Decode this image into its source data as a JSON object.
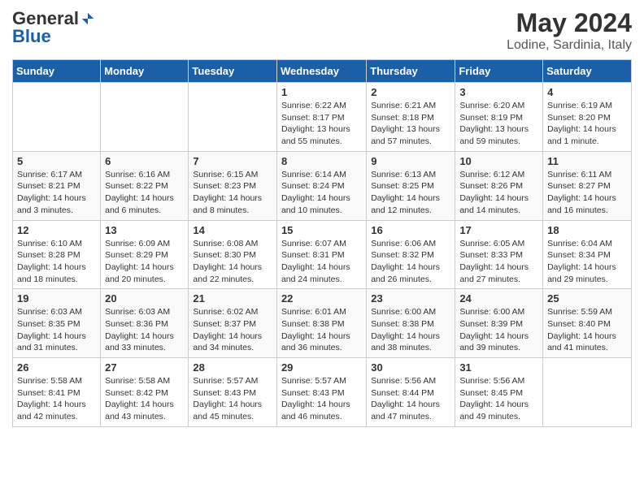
{
  "header": {
    "logo_general": "General",
    "logo_blue": "Blue",
    "month": "May 2024",
    "location": "Lodine, Sardinia, Italy"
  },
  "weekdays": [
    "Sunday",
    "Monday",
    "Tuesday",
    "Wednesday",
    "Thursday",
    "Friday",
    "Saturday"
  ],
  "weeks": [
    [
      null,
      null,
      null,
      {
        "day": 1,
        "sunrise": "6:22 AM",
        "sunset": "8:17 PM",
        "daylight": "13 hours and 55 minutes."
      },
      {
        "day": 2,
        "sunrise": "6:21 AM",
        "sunset": "8:18 PM",
        "daylight": "13 hours and 57 minutes."
      },
      {
        "day": 3,
        "sunrise": "6:20 AM",
        "sunset": "8:19 PM",
        "daylight": "13 hours and 59 minutes."
      },
      {
        "day": 4,
        "sunrise": "6:19 AM",
        "sunset": "8:20 PM",
        "daylight": "14 hours and 1 minute."
      }
    ],
    [
      {
        "day": 5,
        "sunrise": "6:17 AM",
        "sunset": "8:21 PM",
        "daylight": "14 hours and 3 minutes."
      },
      {
        "day": 6,
        "sunrise": "6:16 AM",
        "sunset": "8:22 PM",
        "daylight": "14 hours and 6 minutes."
      },
      {
        "day": 7,
        "sunrise": "6:15 AM",
        "sunset": "8:23 PM",
        "daylight": "14 hours and 8 minutes."
      },
      {
        "day": 8,
        "sunrise": "6:14 AM",
        "sunset": "8:24 PM",
        "daylight": "14 hours and 10 minutes."
      },
      {
        "day": 9,
        "sunrise": "6:13 AM",
        "sunset": "8:25 PM",
        "daylight": "14 hours and 12 minutes."
      },
      {
        "day": 10,
        "sunrise": "6:12 AM",
        "sunset": "8:26 PM",
        "daylight": "14 hours and 14 minutes."
      },
      {
        "day": 11,
        "sunrise": "6:11 AM",
        "sunset": "8:27 PM",
        "daylight": "14 hours and 16 minutes."
      }
    ],
    [
      {
        "day": 12,
        "sunrise": "6:10 AM",
        "sunset": "8:28 PM",
        "daylight": "14 hours and 18 minutes."
      },
      {
        "day": 13,
        "sunrise": "6:09 AM",
        "sunset": "8:29 PM",
        "daylight": "14 hours and 20 minutes."
      },
      {
        "day": 14,
        "sunrise": "6:08 AM",
        "sunset": "8:30 PM",
        "daylight": "14 hours and 22 minutes."
      },
      {
        "day": 15,
        "sunrise": "6:07 AM",
        "sunset": "8:31 PM",
        "daylight": "14 hours and 24 minutes."
      },
      {
        "day": 16,
        "sunrise": "6:06 AM",
        "sunset": "8:32 PM",
        "daylight": "14 hours and 26 minutes."
      },
      {
        "day": 17,
        "sunrise": "6:05 AM",
        "sunset": "8:33 PM",
        "daylight": "14 hours and 27 minutes."
      },
      {
        "day": 18,
        "sunrise": "6:04 AM",
        "sunset": "8:34 PM",
        "daylight": "14 hours and 29 minutes."
      }
    ],
    [
      {
        "day": 19,
        "sunrise": "6:03 AM",
        "sunset": "8:35 PM",
        "daylight": "14 hours and 31 minutes."
      },
      {
        "day": 20,
        "sunrise": "6:03 AM",
        "sunset": "8:36 PM",
        "daylight": "14 hours and 33 minutes."
      },
      {
        "day": 21,
        "sunrise": "6:02 AM",
        "sunset": "8:37 PM",
        "daylight": "14 hours and 34 minutes."
      },
      {
        "day": 22,
        "sunrise": "6:01 AM",
        "sunset": "8:38 PM",
        "daylight": "14 hours and 36 minutes."
      },
      {
        "day": 23,
        "sunrise": "6:00 AM",
        "sunset": "8:38 PM",
        "daylight": "14 hours and 38 minutes."
      },
      {
        "day": 24,
        "sunrise": "6:00 AM",
        "sunset": "8:39 PM",
        "daylight": "14 hours and 39 minutes."
      },
      {
        "day": 25,
        "sunrise": "5:59 AM",
        "sunset": "8:40 PM",
        "daylight": "14 hours and 41 minutes."
      }
    ],
    [
      {
        "day": 26,
        "sunrise": "5:58 AM",
        "sunset": "8:41 PM",
        "daylight": "14 hours and 42 minutes."
      },
      {
        "day": 27,
        "sunrise": "5:58 AM",
        "sunset": "8:42 PM",
        "daylight": "14 hours and 43 minutes."
      },
      {
        "day": 28,
        "sunrise": "5:57 AM",
        "sunset": "8:43 PM",
        "daylight": "14 hours and 45 minutes."
      },
      {
        "day": 29,
        "sunrise": "5:57 AM",
        "sunset": "8:43 PM",
        "daylight": "14 hours and 46 minutes."
      },
      {
        "day": 30,
        "sunrise": "5:56 AM",
        "sunset": "8:44 PM",
        "daylight": "14 hours and 47 minutes."
      },
      {
        "day": 31,
        "sunrise": "5:56 AM",
        "sunset": "8:45 PM",
        "daylight": "14 hours and 49 minutes."
      },
      null
    ]
  ]
}
